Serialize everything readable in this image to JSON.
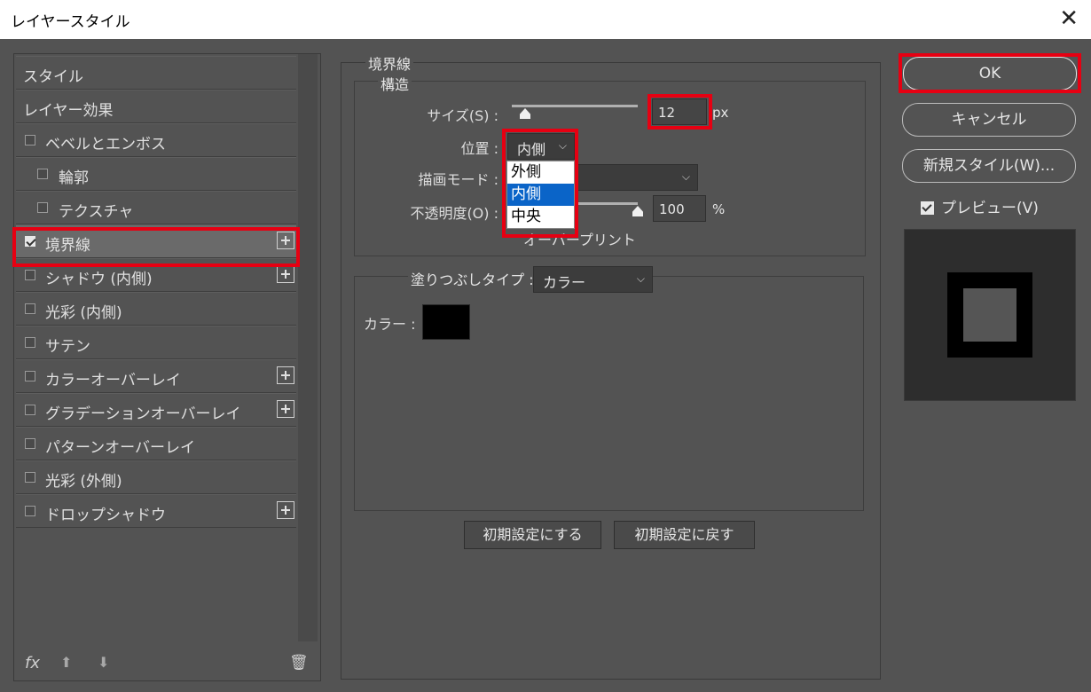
{
  "window": {
    "title": "レイヤースタイル",
    "close_glyph": "✕"
  },
  "sidebar": {
    "items": [
      {
        "label": "スタイル",
        "checkbox": false,
        "plus": false,
        "indent": false
      },
      {
        "label": "レイヤー効果",
        "checkbox": false,
        "plus": false,
        "indent": false
      },
      {
        "label": "ベベルとエンボス",
        "checkbox": true,
        "checked": false,
        "plus": false,
        "indent": false
      },
      {
        "label": "輪郭",
        "checkbox": true,
        "checked": false,
        "plus": false,
        "indent": true
      },
      {
        "label": "テクスチャ",
        "checkbox": true,
        "checked": false,
        "plus": false,
        "indent": true
      },
      {
        "label": "境界線",
        "checkbox": true,
        "checked": true,
        "plus": true,
        "indent": false,
        "selected": true
      },
      {
        "label": "シャドウ (内側)",
        "checkbox": true,
        "checked": false,
        "plus": true,
        "indent": false
      },
      {
        "label": "光彩 (内側)",
        "checkbox": true,
        "checked": false,
        "plus": false,
        "indent": false
      },
      {
        "label": "サテン",
        "checkbox": true,
        "checked": false,
        "plus": false,
        "indent": false
      },
      {
        "label": "カラーオーバーレイ",
        "checkbox": true,
        "checked": false,
        "plus": true,
        "indent": false
      },
      {
        "label": "グラデーションオーバーレイ",
        "checkbox": true,
        "checked": false,
        "plus": true,
        "indent": false
      },
      {
        "label": "パターンオーバーレイ",
        "checkbox": true,
        "checked": false,
        "plus": false,
        "indent": false
      },
      {
        "label": "光彩 (外側)",
        "checkbox": true,
        "checked": false,
        "plus": false,
        "indent": false
      },
      {
        "label": "ドロップシャドウ",
        "checkbox": true,
        "checked": false,
        "plus": true,
        "indent": false
      }
    ],
    "fx_label": "fx",
    "up_glyph": "⬆",
    "down_glyph": "⬇",
    "trash_glyph": "🗑"
  },
  "stroke": {
    "group_title": "境界線",
    "structure_title": "構造",
    "size_label": "サイズ(S) :",
    "size_value": "12",
    "size_unit": "px",
    "position_label": "位置 :",
    "position_value": "内側",
    "position_options": [
      "外側",
      "内側",
      "中央"
    ],
    "position_selected_index": 1,
    "blend_label": "描画モード :",
    "opacity_label": "不透明度(O) :",
    "opacity_value": "100",
    "opacity_unit": "%",
    "overprint_label_partial": "オーバープリント",
    "fill_type_label": "塗りつぶしタイプ :",
    "fill_type_value": "カラー",
    "color_label": "カラー :",
    "color_swatch": "#000000",
    "reset_default_button": "初期設定にする",
    "restore_default_button": "初期設定に戻す"
  },
  "actions": {
    "ok": "OK",
    "cancel": "キャンセル",
    "new_style": "新規スタイル(W)...",
    "preview_label": "プレビュー(V)",
    "preview_checked": true
  },
  "colors": {
    "highlight_red": "#e60012",
    "dropdown_selected": "#0a64c8"
  }
}
